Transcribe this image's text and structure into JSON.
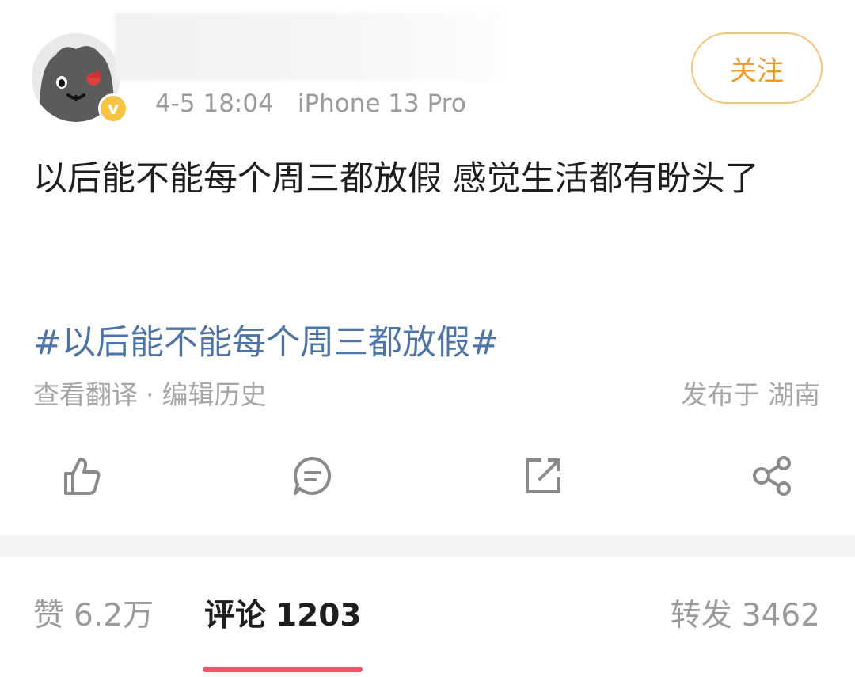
{
  "post": {
    "meta": {
      "time": "4-5 18:04",
      "device": "iPhone 13 Pro"
    },
    "follow_label": "关注",
    "text": "以后能不能每个周三都放假 感觉生活都有盼头了",
    "hashtag": "#以后能不能每个周三都放假#",
    "translate_label": "查看翻译",
    "separator": "·",
    "edit_history_label": "编辑历史",
    "location": "发布于 湖南",
    "badge_letter": "v"
  },
  "actions": {
    "like_icon": "thumbs-up-icon",
    "comment_icon": "comment-bubble-icon",
    "repost_icon": "repost-share-out-icon",
    "share_icon": "share-nodes-icon"
  },
  "tabs": {
    "likes": {
      "label": "赞",
      "count": "6.2万"
    },
    "comments": {
      "label": "评论",
      "count": "1203"
    },
    "reposts": {
      "label": "转发",
      "count": "3462"
    }
  },
  "colors": {
    "accent_orange": "#ef9a2a",
    "hashtag_blue": "#4e74a6",
    "active_tab_underline": "#f0546b",
    "badge_yellow": "#f6c343"
  }
}
